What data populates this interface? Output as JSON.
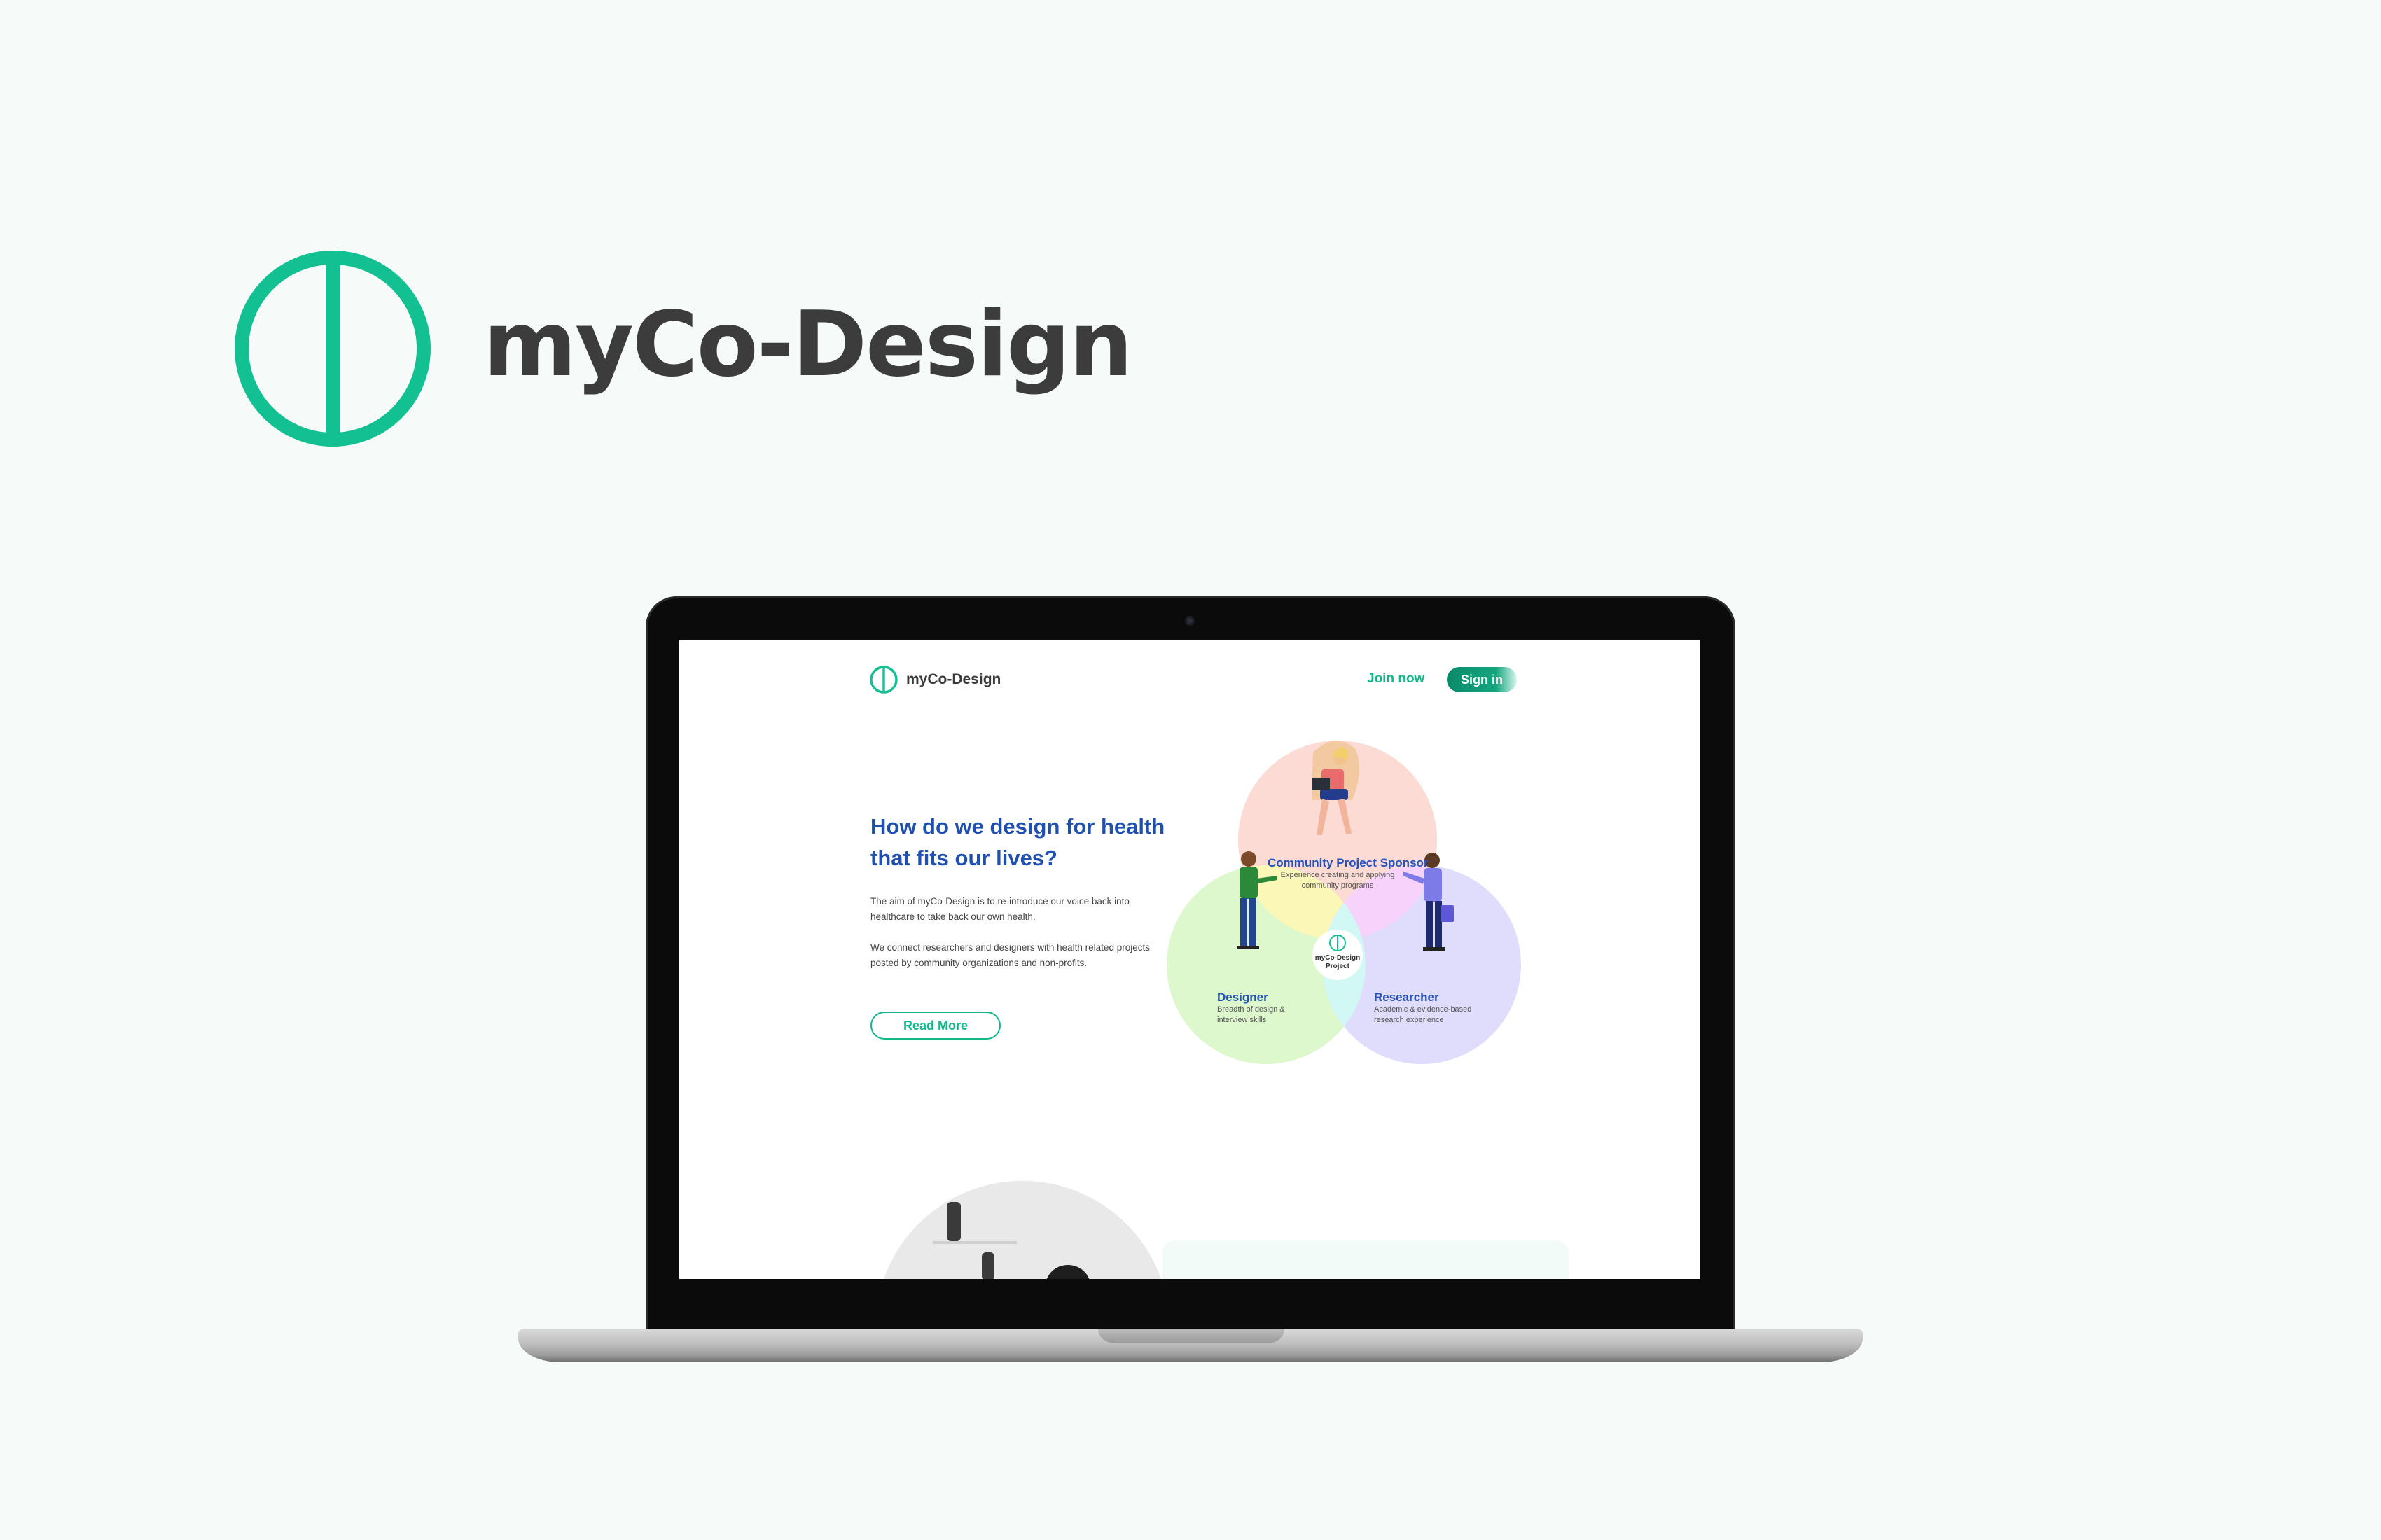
{
  "brand": {
    "name": "myCo-Design",
    "color": "#12c091"
  },
  "nav": {
    "logo_text": "myCo-Design",
    "join_label": "Join now",
    "signin_label": "Sign in"
  },
  "hero": {
    "heading": "How do we design for health that fits our lives?",
    "paragraph1": "The aim of myCo-Design is to re-introduce our voice back into healthcare to take back our own health.",
    "paragraph2": "We connect researchers and designers with health related projects posted by community organizations and non-profits.",
    "readmore_label": "Read More"
  },
  "venn": {
    "sponsor": {
      "title": "Community Project Sponsor",
      "line1": "Experience creating and applying",
      "line2": "community programs",
      "color": "#f9c9bf"
    },
    "designer": {
      "title": "Designer",
      "line1": "Breadth of design &",
      "line2": "interview skills",
      "color": "#d7f7c4"
    },
    "researcher": {
      "title": "Researcher",
      "line1": "Academic & evidence-based",
      "line2": "research experience",
      "color": "#d7d3fb"
    },
    "center": {
      "line1": "myCo-Design",
      "line2": "Project"
    }
  }
}
